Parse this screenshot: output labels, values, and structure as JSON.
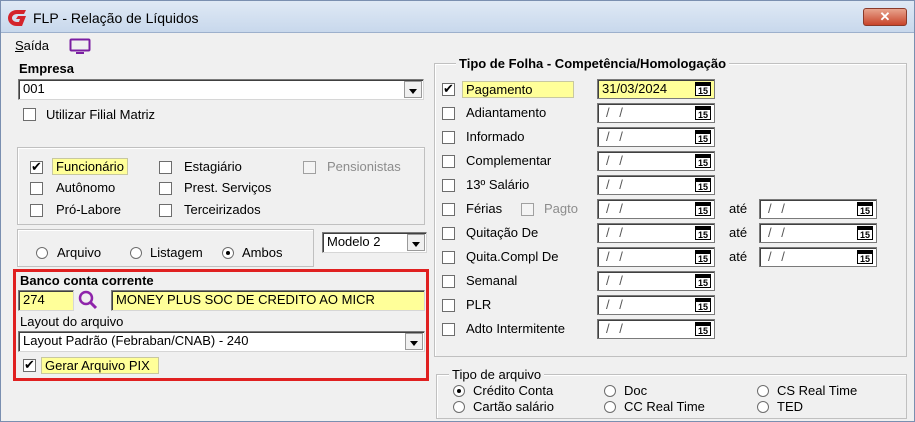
{
  "window": {
    "title": "FLP - Relação de Líquidos",
    "close_label": "✕"
  },
  "menu": {
    "saida_prefix": "S",
    "saida_rest": "aída"
  },
  "empresa": {
    "label": "Empresa",
    "value": "001",
    "utilizar_filial_label": "Utilizar Filial Matriz",
    "utilizar_filial_checked": false
  },
  "tipos": {
    "funcionario": {
      "label": "Funcionário",
      "checked": true
    },
    "autonomo": {
      "label": "Autônomo",
      "checked": false
    },
    "pro_labore": {
      "label": "Pró-Labore",
      "checked": false
    },
    "estagiario": {
      "label": "Estagiário",
      "checked": false
    },
    "prest_servicos": {
      "label": "Prest. Serviços",
      "checked": false
    },
    "terceirizados": {
      "label": "Terceirizados",
      "checked": false
    },
    "pensionistas": {
      "label": "Pensionistas",
      "checked": false,
      "disabled": true
    }
  },
  "saida_tipo": {
    "arquivo": "Arquivo",
    "listagem": "Listagem",
    "ambos": "Ambos",
    "selected": "Ambos"
  },
  "modelo": {
    "value": "Modelo 2"
  },
  "banco": {
    "label": "Banco conta corrente",
    "code": "274",
    "name": "MONEY PLUS SOC DE CREDITO AO MICR"
  },
  "layout": {
    "label": "Layout do arquivo",
    "value": "Layout Padrão (Febraban/CNAB) - 240"
  },
  "gerar_pix": {
    "label": "Gerar Arquivo PIX",
    "checked": true
  },
  "folha": {
    "title": "Tipo de Folha  -  Competência/Homologação",
    "ate_label": "até",
    "empty_date": "/ /",
    "cal_label": "15",
    "rows": [
      {
        "label": "Pagamento",
        "checked": true,
        "date": "31/03/2024"
      },
      {
        "label": "Adiantamento",
        "checked": false,
        "date": "/ /"
      },
      {
        "label": "Informado",
        "checked": false,
        "date": "/ /"
      },
      {
        "label": "Complementar",
        "checked": false,
        "date": "/ /"
      },
      {
        "label": "13º Salário",
        "checked": false,
        "date": "/ /"
      },
      {
        "label": "Férias",
        "checked": false,
        "date": "/ /",
        "extra_label": "Pagto",
        "ate_date": "/ /"
      },
      {
        "label": "Quitação De",
        "checked": false,
        "date": "/ /",
        "ate_date": "/ /"
      },
      {
        "label": "Quita.Compl De",
        "checked": false,
        "date": "/ /",
        "ate_date": "/ /"
      },
      {
        "label": "Semanal",
        "checked": false,
        "date": "/ /"
      },
      {
        "label": "PLR",
        "checked": false,
        "date": "/ /"
      },
      {
        "label": "Adto Intermitente",
        "checked": false,
        "date": "/ /"
      }
    ]
  },
  "tipo_arquivo": {
    "title": "Tipo de arquivo",
    "options": [
      "Crédito Conta",
      "Cartão salário",
      "Doc",
      "CC Real Time",
      "CS Real Time",
      "TED"
    ],
    "selected": "Crédito Conta"
  },
  "colors": {
    "highlight": "#ffff99",
    "frame": "#e02020",
    "logo": "#d4232b",
    "monitor": "#7b1fa2",
    "search": "#8e24aa"
  }
}
